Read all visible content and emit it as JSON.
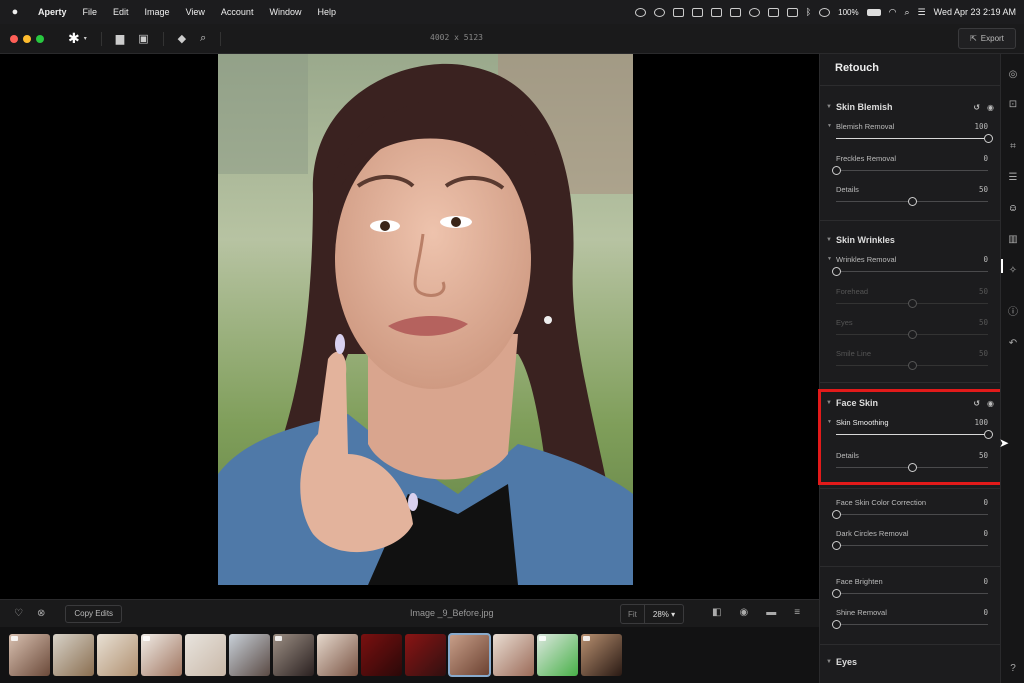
{
  "menubar": {
    "app_name": "Aperty",
    "items": [
      "File",
      "Edit",
      "Image",
      "View",
      "Account",
      "Window",
      "Help"
    ],
    "battery": "100%",
    "clock": "Wed Apr 23  2:19 AM"
  },
  "toolbar": {
    "dimensions": "4002 x 5123",
    "export_label": "Export"
  },
  "bottombar": {
    "copy_edits_label": "Copy Edits",
    "filename": "Image _9_Before.jpg",
    "fit_label": "Fit",
    "zoom_value": "28%"
  },
  "panel": {
    "title": "Retouch",
    "sections": {
      "skin_blemish": {
        "title": "Skin Blemish",
        "sliders": [
          {
            "label": "Blemish Removal",
            "value": "100",
            "level": 1.0
          },
          {
            "label": "Freckles Removal",
            "value": "0",
            "level": 0.0
          },
          {
            "label": "Details",
            "value": "50",
            "level": 0.5
          }
        ]
      },
      "skin_wrinkles": {
        "title": "Skin Wrinkles",
        "sliders": [
          {
            "label": "Wrinkles Removal",
            "value": "0",
            "level": 0.0
          },
          {
            "label": "Forehead",
            "value": "50",
            "level": 0.5
          },
          {
            "label": "Eyes",
            "value": "50",
            "level": 0.5
          },
          {
            "label": "Smile Line",
            "value": "50",
            "level": 0.5
          }
        ]
      },
      "face_skin": {
        "title": "Face Skin",
        "sliders": [
          {
            "label": "Skin Smoothing",
            "value": "100",
            "level": 1.0
          },
          {
            "label": "Details",
            "value": "50",
            "level": 0.5
          }
        ]
      },
      "face_tools": {
        "sliders": [
          {
            "label": "Face Skin Color Correction",
            "value": "0",
            "level": 0.0
          },
          {
            "label": "Dark Circles Removal",
            "value": "0",
            "level": 0.0
          },
          {
            "label": "Face Brighten",
            "value": "0",
            "level": 0.0
          },
          {
            "label": "Shine Removal",
            "value": "0",
            "level": 0.0
          }
        ]
      },
      "eyes": {
        "title": "Eyes"
      }
    }
  },
  "colors": {
    "highlight": "#e21a1a",
    "traffic_red": "#ff5f57",
    "traffic_yellow": "#febc2e",
    "traffic_green": "#28c840"
  }
}
